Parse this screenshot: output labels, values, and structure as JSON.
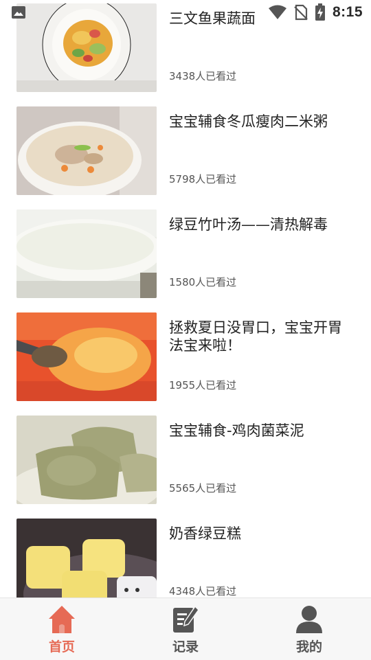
{
  "status_bar": {
    "time": "8:15",
    "icons": [
      "gallery-notification-icon",
      "wifi-icon",
      "no-sim-icon",
      "battery-charging-icon"
    ]
  },
  "feed": {
    "items": [
      {
        "title": "三文鱼果蔬面",
        "views": "3438人已看过",
        "thumbnail": "plate-with-vegetable-noodles"
      },
      {
        "title": "宝宝辅食冬瓜瘦肉二米粥",
        "views": "5798人已看过",
        "thumbnail": "bowl-of-porridge"
      },
      {
        "title": "绿豆竹叶汤——清热解毒",
        "views": "1580人已看过",
        "thumbnail": "glass-bowl-soup"
      },
      {
        "title": "拯救夏日没胃口，宝宝开胃法宝来啦！",
        "views": "1955人已看过",
        "thumbnail": "spoon-of-orange-dessert"
      },
      {
        "title": "宝宝辅食-鸡肉菌菜泥",
        "views": "5565人已看过",
        "thumbnail": "green-steamed-cakes"
      },
      {
        "title": "奶香绿豆糕",
        "views": "4348人已看过",
        "thumbnail": "mung-bean-cakes"
      }
    ]
  },
  "bottom_nav": {
    "active_color": "#e66a55",
    "inactive_color": "#555555",
    "items": [
      {
        "label": "首页",
        "icon": "home-icon",
        "active": true
      },
      {
        "label": "记录",
        "icon": "edit-record-icon",
        "active": false
      },
      {
        "label": "我的",
        "icon": "profile-icon",
        "active": false
      }
    ]
  }
}
